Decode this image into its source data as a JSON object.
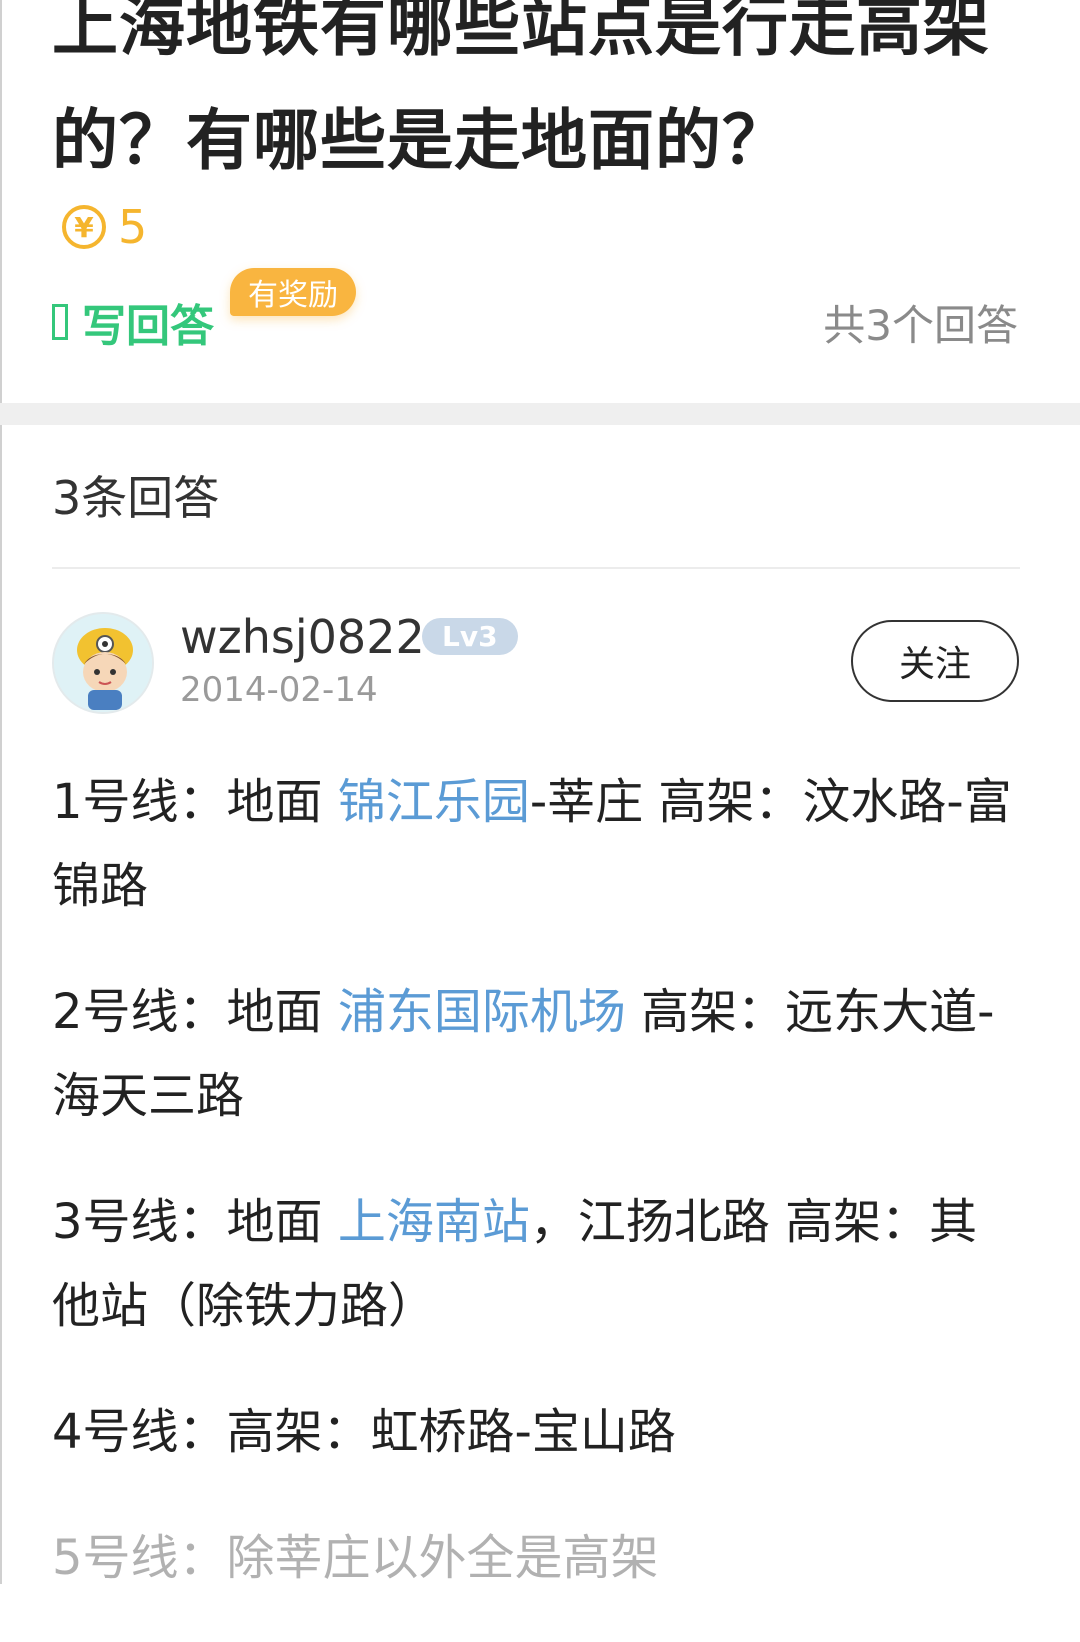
{
  "question": {
    "title": "上海地铁有哪些站点是行走高架的？有哪些是走地面的？",
    "reward_symbol": "¥",
    "reward_amount": "5",
    "write_answer_label": "写回答",
    "reward_badge": "有奖励",
    "answer_count_label": "共3个回答"
  },
  "answers_section": {
    "heading": "3条回答"
  },
  "answer": {
    "username": "wzhsj0822",
    "level": "Lv3",
    "date": "2014-02-14",
    "follow_label": "关注",
    "paragraphs": [
      {
        "pre": "1号线：地面 ",
        "link": "锦江乐园",
        "post": "-莘庄 高架：汶水路-富锦路"
      },
      {
        "pre": "2号线：地面 ",
        "link": "浦东国际机场",
        "post": " 高架：远东大道-海天三路"
      },
      {
        "pre": "3号线：地面 ",
        "link": "上海南站",
        "post": "，江扬北路 高架：其他站（除铁力路）"
      },
      {
        "pre": "4号线：高架：虹桥路-宝山路",
        "link": "",
        "post": ""
      },
      {
        "pre": "5号线：除莘庄以外全是高架",
        "link": "",
        "post": ""
      }
    ]
  },
  "colors": {
    "accent_green": "#34c77b",
    "reward_gold": "#f5b52e",
    "link_blue": "#5b9bd5",
    "badge_orange": "#f9b540"
  }
}
